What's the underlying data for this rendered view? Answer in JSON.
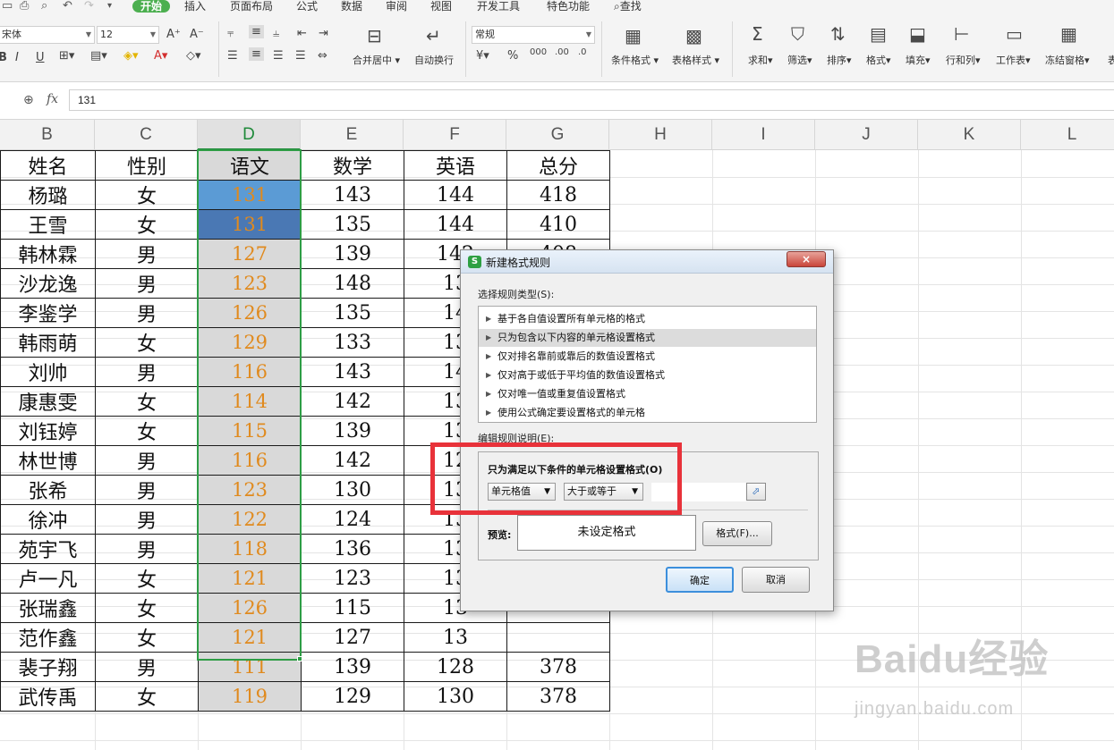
{
  "menubar": {
    "tabs": [
      "开始",
      "插入",
      "页面布局",
      "公式",
      "数据",
      "审阅",
      "视图",
      "开发工具",
      "特色功能"
    ],
    "search_label": "查找"
  },
  "toolbar": {
    "font_name": "宋体",
    "font_size": "12",
    "merge_center": "合并居中",
    "wrap_text": "自动换行",
    "number_format": "常规",
    "conditional_format": "条件格式",
    "table_style": "表格样式",
    "sum": "求和",
    "filter": "筛选",
    "sort": "排序",
    "format": "格式",
    "fill": "填充",
    "rows_cols": "行和列",
    "worksheet": "工作表",
    "freeze_panes": "冻结窗格",
    "more": "表"
  },
  "formula_bar": {
    "fx": "fx",
    "value": "131"
  },
  "columns": [
    "B",
    "C",
    "D",
    "E",
    "F",
    "G",
    "H",
    "I",
    "J",
    "K",
    "L"
  ],
  "table": {
    "headers": [
      "姓名",
      "性别",
      "语文",
      "数学",
      "英语",
      "总分"
    ],
    "rows": [
      [
        "杨璐",
        "女",
        "131",
        "143",
        "144",
        "418"
      ],
      [
        "王雪",
        "女",
        "131",
        "135",
        "144",
        "410"
      ],
      [
        "韩林霖",
        "男",
        "127",
        "139",
        "142",
        "408"
      ],
      [
        "沙龙逸",
        "男",
        "123",
        "148",
        "13",
        ""
      ],
      [
        "李鉴学",
        "男",
        "126",
        "135",
        "14",
        ""
      ],
      [
        "韩雨萌",
        "女",
        "129",
        "133",
        "13",
        ""
      ],
      [
        "刘帅",
        "男",
        "116",
        "143",
        "14",
        ""
      ],
      [
        "康惠雯",
        "女",
        "114",
        "142",
        "13",
        ""
      ],
      [
        "刘钰婷",
        "女",
        "115",
        "139",
        "13",
        ""
      ],
      [
        "林世博",
        "男",
        "116",
        "142",
        "12",
        ""
      ],
      [
        "张希",
        "男",
        "123",
        "130",
        "13",
        ""
      ],
      [
        "徐冲",
        "男",
        "122",
        "124",
        "13",
        ""
      ],
      [
        "苑宇飞",
        "男",
        "118",
        "136",
        "13",
        ""
      ],
      [
        "卢一凡",
        "女",
        "121",
        "123",
        "13",
        ""
      ],
      [
        "张瑞鑫",
        "女",
        "126",
        "115",
        "13",
        ""
      ],
      [
        "范作鑫",
        "女",
        "121",
        "127",
        "13",
        ""
      ],
      [
        "裴子翔",
        "男",
        "111",
        "139",
        "128",
        "378"
      ],
      [
        "武传禹",
        "女",
        "119",
        "129",
        "130",
        "378"
      ]
    ]
  },
  "dialog": {
    "title": "新建格式规则",
    "close": "×",
    "select_rule_type_label": "选择规则类型(S):",
    "rule_types": [
      "基于各自值设置所有单元格的格式",
      "只为包含以下内容的单元格设置格式",
      "仅对排名靠前或靠后的数值设置格式",
      "仅对高于或低于平均值的数值设置格式",
      "仅对唯一值或重复值设置格式",
      "使用公式确定要设置格式的单元格"
    ],
    "selected_rule_index": 1,
    "edit_rule_label": "编辑规则说明(E):",
    "condition_title": "只为满足以下条件的单元格设置格式(O)",
    "condition_field": "单元格值",
    "condition_operator": "大于或等于",
    "condition_value": "",
    "preview_label": "预览:",
    "preview_text": "未设定格式",
    "format_button": "格式(F)...",
    "ok_button": "确定",
    "cancel_button": "取消"
  },
  "watermark": {
    "logo": "Baidu经验",
    "url": "jingyan.baidu.com"
  },
  "colors": {
    "accent_green": "#4caf50",
    "selection_green": "#2e9d45",
    "highlight_red": "#e8323a",
    "cell_highlight_1": "#5b9bd5",
    "cell_highlight_2": "#4a78b4",
    "number_orange": "#e08a1e"
  }
}
